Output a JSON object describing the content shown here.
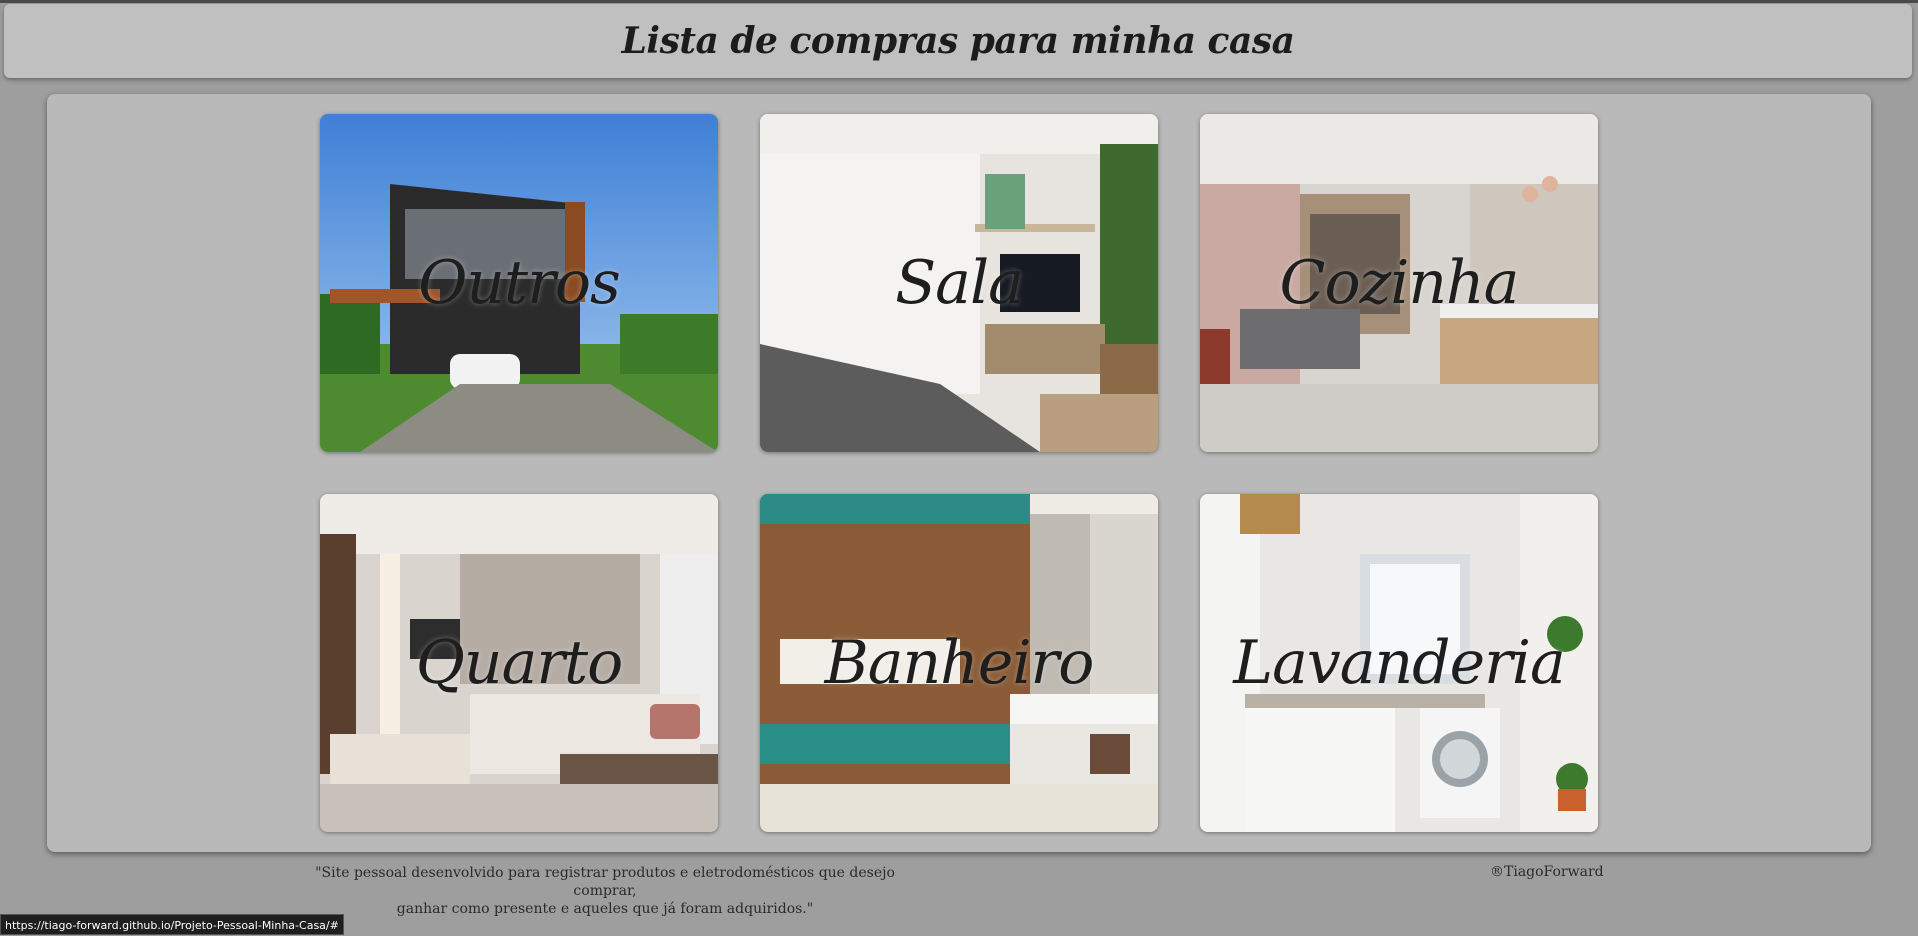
{
  "header": {
    "title": "Lista de compras para minha casa"
  },
  "cards": [
    {
      "label": "Outros"
    },
    {
      "label": "Sala"
    },
    {
      "label": "Cozinha"
    },
    {
      "label": "Quarto"
    },
    {
      "label": "Banheiro"
    },
    {
      "label": "Lavanderia"
    }
  ],
  "footer": {
    "line1": "\"Site pessoal desenvolvido para registrar produtos e eletrodomésticos que desejo comprar,",
    "line2": "ganhar como presente e aqueles que já foram adquiridos.\"",
    "copyright": "®TiagoForward"
  },
  "status_bar": {
    "url": "https://tiago-forward.github.io/Projeto-Pessoal-Minha-Casa/#"
  }
}
